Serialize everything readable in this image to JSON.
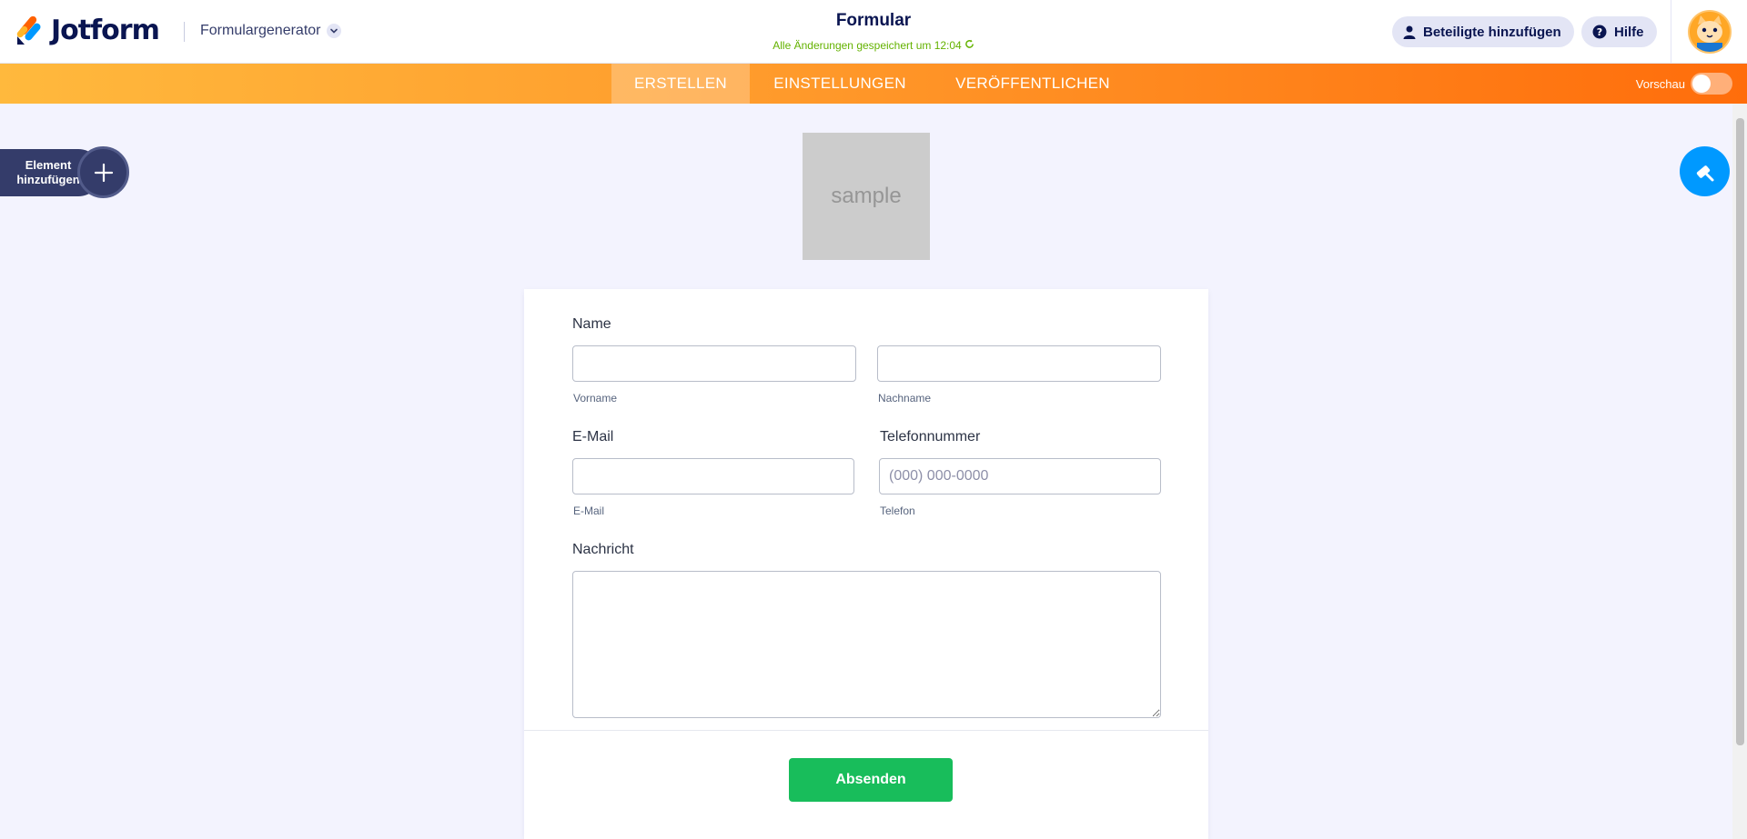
{
  "header": {
    "logo_text": "Jotform",
    "builder_label": "Formulargenerator",
    "form_title": "Formular",
    "save_status": "Alle Änderungen gespeichert um 12:04",
    "add_participants_label": "Beteiligte hinzufügen",
    "help_label": "Hilfe"
  },
  "nav": {
    "tabs": [
      {
        "label": "ERSTELLEN",
        "active": true
      },
      {
        "label": "EINSTELLUNGEN",
        "active": false
      },
      {
        "label": "VERÖFFENTLICHEN",
        "active": false
      }
    ],
    "preview_label": "Vorschau",
    "preview_enabled": false
  },
  "sidebar": {
    "add_element_label": "Element hinzufügen"
  },
  "form": {
    "logo_placeholder": "sample",
    "name_label": "Name",
    "first_name_sublabel": "Vorname",
    "last_name_sublabel": "Nachname",
    "email_label": "E-Mail",
    "email_sublabel": "E-Mail",
    "phone_label": "Telefonnummer",
    "phone_placeholder": "(000) 000-0000",
    "phone_sublabel": "Telefon",
    "message_label": "Nachricht",
    "submit_label": "Absenden"
  },
  "colors": {
    "brand_navy": "#0a1551",
    "nav_orange_start": "#ffb93d",
    "nav_orange_end": "#ff6d0b",
    "submit_green": "#18bd5b",
    "paint_blue": "#0099ff",
    "save_green": "#64b200"
  }
}
